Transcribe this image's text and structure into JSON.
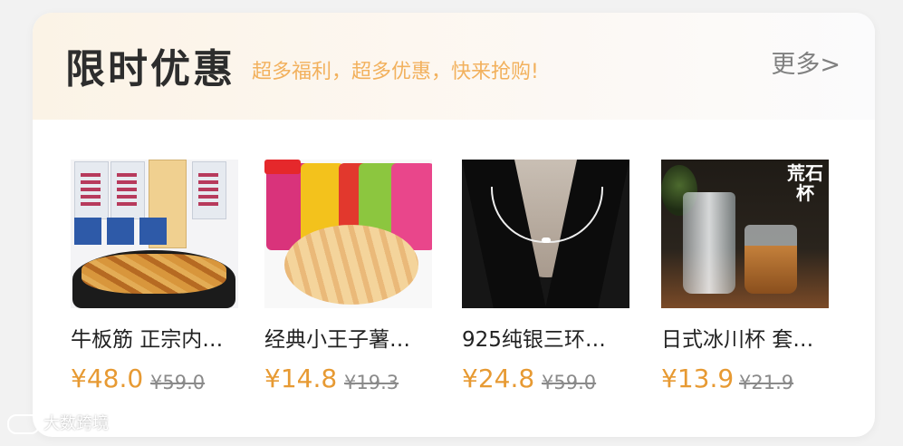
{
  "header": {
    "title": "限时优惠",
    "subtitle": "超多福利，超多优惠，快来抢购!",
    "more_label": "更多>"
  },
  "products": [
    {
      "name": "牛板筋 正宗内…",
      "price": "¥48.0",
      "original_price": "¥59.0"
    },
    {
      "name": "经典小王子薯…",
      "price": "¥14.8",
      "original_price": "¥19.3"
    },
    {
      "name": "925纯银三环…",
      "price": "¥24.8",
      "original_price": "¥59.0"
    },
    {
      "name": "日式冰川杯 套…",
      "price": "¥13.9",
      "original_price": "¥21.9"
    }
  ],
  "image_tag": "荒石杯",
  "watermark": "大数跨境",
  "colors": {
    "price": "#e79a33",
    "subtitle": "#f2b15d",
    "title": "#2d2d2d"
  }
}
